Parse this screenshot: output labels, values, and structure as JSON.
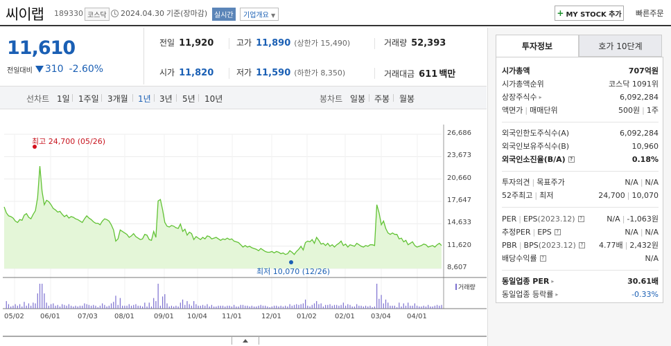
{
  "stock": {
    "name": "씨이랩",
    "code": "189330",
    "market": "코스닥",
    "date": "2024.04.30",
    "basis": "기준(장마감)",
    "realtime_label": "실시간",
    "overview_label": "기업개요"
  },
  "actions": {
    "my_stock": "MY STOCK 추가",
    "quick_order": "빠른주문"
  },
  "price": {
    "current": "11,610",
    "change_label": "전일대비",
    "change": "310",
    "change_pct": "-2.60%",
    "direction": "down",
    "color": "#1a5fb4"
  },
  "stats": {
    "prev_close_label": "전일",
    "prev_close": "11,920",
    "high_label": "고가",
    "high": "11,890",
    "upper_limit": "(상한가 15,490)",
    "volume_label": "거래량",
    "volume": "52,393",
    "open_label": "시가",
    "open": "11,820",
    "low_label": "저가",
    "low": "11,590",
    "lower_limit": "(하한가 8,350)",
    "amount_label": "거래대금",
    "amount": "611",
    "amount_unit": "백만"
  },
  "period": {
    "line_label": "선차트",
    "line_periods": [
      "1일",
      "1주일",
      "3개월",
      "1년",
      "3년",
      "5년",
      "10년"
    ],
    "selected": "1년",
    "candle_label": "봉차트",
    "candle_periods": [
      "일봉",
      "주봉",
      "월봉"
    ]
  },
  "chart_data": {
    "type": "line",
    "y_ticks": [
      "26,686",
      "23,673",
      "20,660",
      "17,647",
      "14,633",
      "11,620",
      "8,607"
    ],
    "ylim": [
      8607,
      26686
    ],
    "x_ticks": [
      "05/02",
      "06/01",
      "07/03",
      "08/01",
      "09/01",
      "10/04",
      "11/01",
      "12/01",
      "01/02",
      "02/01",
      "03/04",
      "04/01"
    ],
    "max_annotation": "최고 24,700 (05/26)",
    "min_annotation": "최저 10,070 (12/26)",
    "volume_legend": "거래량",
    "line_color": "#61c234",
    "fill_color": "#e4f6d8",
    "series": [
      {
        "values": [
          16900,
          16100,
          15700,
          15600,
          15400,
          15000,
          14800,
          15200,
          15100,
          15800,
          16000,
          15500,
          15300,
          15900,
          16400,
          18200,
          22400,
          19000,
          17200,
          17800,
          17600,
          17200,
          16700,
          16500,
          16200,
          16300,
          15900,
          15600,
          15800,
          15400,
          15600,
          15500,
          15300,
          15200,
          15000,
          14800,
          15300,
          15700,
          15400,
          15200,
          14900,
          14700,
          14700,
          14500,
          15000,
          15300,
          15200,
          15000,
          14500,
          13800,
          12300,
          12600,
          13800,
          13600,
          13400,
          13200,
          12800,
          13000,
          13300,
          12900,
          12700,
          12500,
          12600,
          13200,
          13100,
          12500,
          12400,
          13600,
          12800,
          17700,
          17900,
          16500,
          14800,
          14300,
          14200,
          14400,
          14300,
          14100,
          14000,
          14600,
          13600,
          13900,
          13100,
          13500,
          13300,
          12500,
          12900,
          12700,
          12500,
          12800,
          12600,
          13000,
          12900,
          12600,
          12700,
          12800,
          12600,
          12400,
          12600,
          12500,
          12700,
          12500,
          12600,
          12300,
          12200,
          12100,
          11800,
          11500,
          11700,
          11500,
          11600,
          11400,
          11300,
          11200,
          11000,
          11300,
          11100,
          10900,
          10800,
          10800,
          10900,
          10700,
          10900,
          10800,
          10600,
          10700,
          10500,
          10600,
          11000,
          10800,
          10500,
          10900,
          11200,
          11600,
          11100,
          12100,
          12300,
          12200,
          12500,
          12000,
          12800,
          12400,
          11900,
          12000,
          11700,
          12000,
          11600,
          11800,
          11500,
          11800,
          12000,
          12300,
          11700,
          11900,
          11500,
          11800,
          11700,
          11600,
          12000,
          11800,
          11600,
          11500,
          11700,
          11600,
          11800,
          11800,
          11700,
          17200,
          16100,
          14500,
          15000,
          14000,
          13400,
          13200,
          13400,
          13200,
          13200,
          12600,
          12700,
          12200,
          12400,
          11800,
          12000,
          12200,
          11700,
          11500,
          11600,
          11700,
          11900,
          11800,
          11500,
          11600,
          11700,
          11500,
          11800,
          12000,
          11700
        ]
      }
    ]
  },
  "right_panel": {
    "tab_active": "투자정보",
    "tab_other": "호가 10단계",
    "market_cap_label": "시가총액",
    "market_cap": "707억원",
    "market_cap_rank_label": "시가총액순위",
    "market_cap_rank": "코스닥 1091위",
    "shares_label": "상장주식수",
    "shares": "6,092,284",
    "par_label": "액면가",
    "unit_label": "매매단위",
    "par": "500원",
    "unit": "1주",
    "foreign_limit_label": "외국인한도주식수(A)",
    "foreign_limit": "6,092,284",
    "foreign_held_label": "외국인보유주식수(B)",
    "foreign_held": "10,960",
    "foreign_ratio_label": "외국인소진율(B/A)",
    "foreign_ratio": "0.18%",
    "opinion_label": "투자의견",
    "target_label": "목표주가",
    "opinion": "N/A",
    "target": "N/A",
    "w52_high_label": "52주최고",
    "w52_low_label": "최저",
    "w52_high": "24,700",
    "w52_low": "10,070",
    "per_label": "PER",
    "eps_label": "EPS",
    "eps_period": "(2023.12)",
    "per": "N/A",
    "eps": "-1,063원",
    "est_per_label": "추정PER",
    "est_eps_label": "EPS",
    "est_per": "N/A",
    "est_eps": "N/A",
    "pbr_label": "PBR",
    "bps_label": "BPS",
    "bps_period": "(2023.12)",
    "pbr": "4.77배",
    "bps": "2,432원",
    "dividend_label": "배당수익률",
    "dividend": "N/A",
    "industry_per_label": "동일업종 PER",
    "industry_per": "30.61배",
    "industry_change_label": "동일업종 등락률",
    "industry_change": "-0.33%"
  }
}
